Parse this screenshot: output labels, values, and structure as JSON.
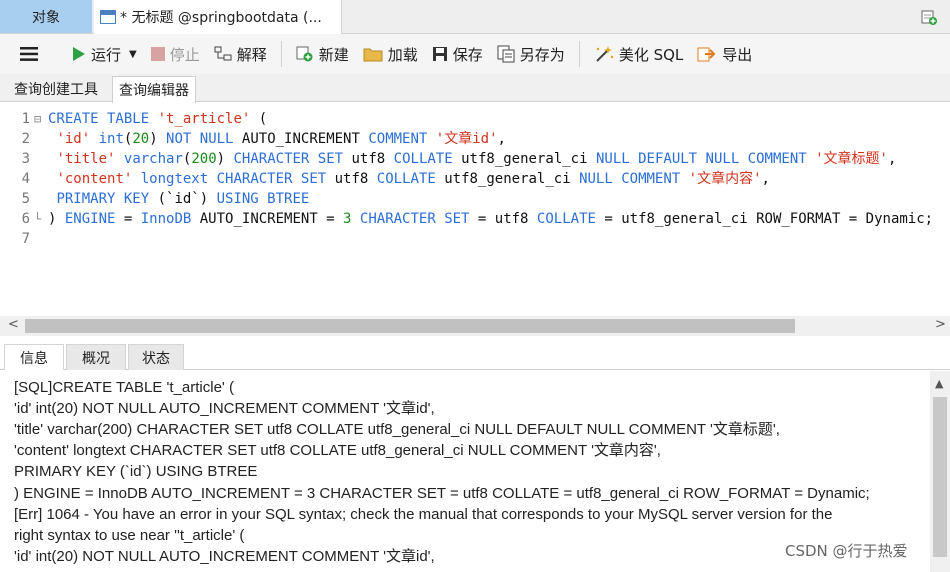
{
  "tabs": {
    "objects": "对象",
    "query": "* 无标题 @springbootdata (..."
  },
  "toolbar": {
    "run": "运行",
    "stop": "停止",
    "explain": "解释",
    "new": "新建",
    "load": "加载",
    "save": "保存",
    "save_as": "另存为",
    "beautify": "美化 SQL",
    "export": "导出"
  },
  "subtabs": [
    "查询创建工具",
    "查询编辑器"
  ],
  "editor": {
    "line_numbers": [
      "1",
      "2",
      "3",
      "4",
      "5",
      "6",
      "7"
    ],
    "l1": [
      "CREATE TABLE",
      " ",
      "'t_article'",
      "  ("
    ],
    "l2": [
      "'id'",
      " ",
      "int",
      "(",
      "20",
      ") ",
      "NOT NULL",
      " AUTO_INCREMENT ",
      "COMMENT",
      " ",
      "'文章id'",
      ","
    ],
    "l3": [
      "'title'",
      " ",
      "varchar",
      "(",
      "200",
      ") ",
      "CHARACTER SET",
      " utf8 ",
      "COLLATE",
      " utf8_general_ci ",
      "NULL DEFAULT NULL COMMENT",
      " ",
      "'文章标题'",
      ","
    ],
    "l4": [
      "'content'",
      " ",
      "longtext",
      " ",
      "CHARACTER SET",
      " utf8 ",
      "COLLATE",
      " utf8_general_ci ",
      "NULL COMMENT",
      " ",
      "'文章内容'",
      ","
    ],
    "l5": [
      "PRIMARY KEY",
      " (`id`) ",
      "USING BTREE"
    ],
    "l6": [
      ") ",
      "ENGINE",
      " = ",
      "InnoDB",
      " AUTO_INCREMENT = ",
      "3",
      " ",
      "CHARACTER SET",
      " = utf8 ",
      "COLLATE",
      " = utf8_general_ci ROW_FORMAT = Dynamic;"
    ]
  },
  "info_tabs": [
    "信息",
    "概况",
    "状态"
  ],
  "messages": [
    "[SQL]CREATE TABLE 't_article'  (",
    "  'id' int(20) NOT NULL AUTO_INCREMENT COMMENT '文章id',",
    "  'title' varchar(200) CHARACTER SET utf8 COLLATE utf8_general_ci NULL DEFAULT NULL COMMENT '文章标题',",
    "  'content' longtext CHARACTER SET utf8 COLLATE utf8_general_ci NULL COMMENT '文章内容',",
    "  PRIMARY KEY (`id`) USING BTREE",
    ") ENGINE = InnoDB AUTO_INCREMENT = 3 CHARACTER SET = utf8 COLLATE = utf8_general_ci ROW_FORMAT = Dynamic;",
    "[Err] 1064 - You have an error in your SQL syntax; check the manual that corresponds to your MySQL server version for the",
    "right syntax to use near ''t_article'  (",
    "  'id' int(20) NOT NULL AUTO_INCREMENT COMMENT '文章id',"
  ],
  "watermark": "CSDN @行于热爱",
  "colors": {
    "keyword": "#2b6fd6",
    "string": "#d0331c",
    "number": "#1a8a1a",
    "active_tab": "#a8cff0"
  }
}
